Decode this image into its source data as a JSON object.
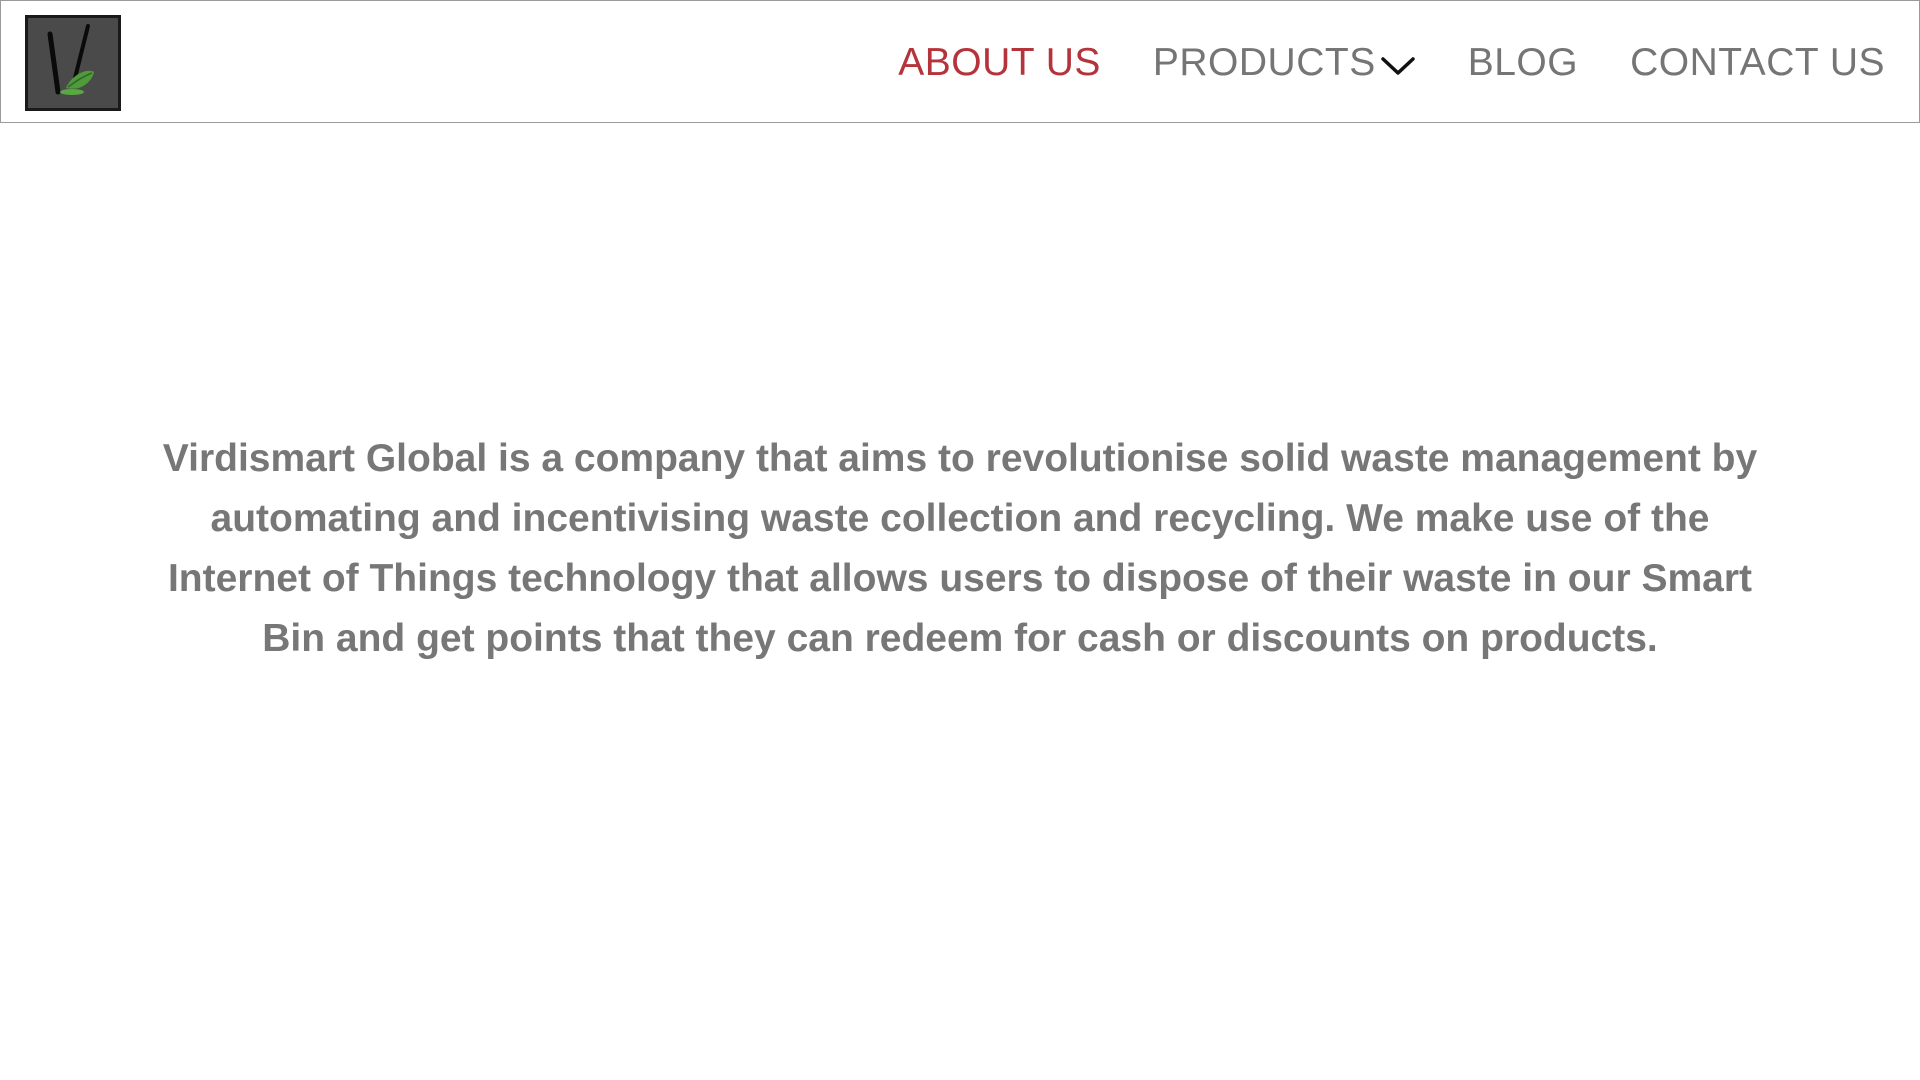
{
  "header": {
    "logo_icon": "virdismart-leaf-logo-icon",
    "nav": [
      {
        "label": "ABOUT US",
        "active": true
      },
      {
        "label": "PRODUCTS",
        "has_dropdown": true,
        "dropdown_icon": "chevron-down-icon"
      },
      {
        "label": "BLOG"
      },
      {
        "label": "CONTACT US"
      }
    ]
  },
  "main": {
    "intro_text": "Virdismart Global is a company that aims to revolutionise solid waste management by automating and incentivising waste collection and recycling. We make use of the Internet of Things technology that allows users to dispose of their waste in our Smart Bin and get points that they can redeem for cash or discounts on products."
  },
  "colors": {
    "active_nav": "#b5333a",
    "nav_text": "#757575",
    "body_text": "#777777",
    "header_border": "#9a9a9a",
    "logo_background": "#4a4a4a",
    "leaf_green": "#4f9a3a"
  }
}
